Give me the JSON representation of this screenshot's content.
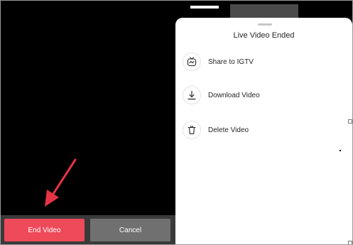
{
  "sheet": {
    "title": "Live Video Ended",
    "items": [
      {
        "label": "Share to IGTV",
        "icon": "igtv-icon"
      },
      {
        "label": "Download Video",
        "icon": "download-icon"
      },
      {
        "label": "Delete Video",
        "icon": "trash-icon"
      }
    ]
  },
  "actions": {
    "end_label": "End Video",
    "cancel_label": "Cancel"
  },
  "colors": {
    "end_button": "#ee4a5a",
    "cancel_button": "#707070",
    "arrow": "#e53345",
    "background": "#000000",
    "sheet": "#ffffff"
  }
}
